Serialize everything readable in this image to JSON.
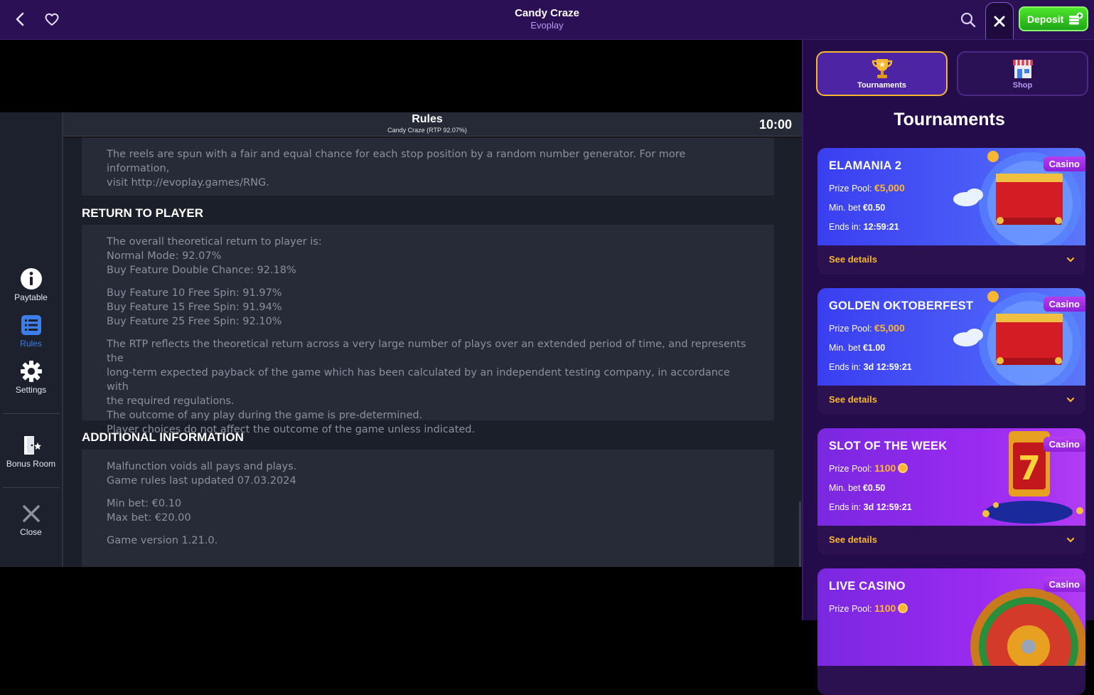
{
  "header": {
    "title": "Candy Craze",
    "provider": "Evoplay",
    "deposit_label": "Deposit"
  },
  "leftnav": {
    "paytable": "Paytable",
    "rules": "Rules",
    "settings": "Settings",
    "bonus_room": "Bonus Room",
    "close": "Close"
  },
  "rules": {
    "title": "Rules",
    "subtitle": "Candy Craze (RTP 92.07%)",
    "clock": "10:00",
    "rng_line1": "The reels are spun with a fair and equal chance for each stop position by a random number generator. For more information,",
    "rng_line2": "visit http://evoplay.games/RNG.",
    "rtp_heading": "RETURN TO PLAYER",
    "rtp_lines": [
      "The overall theoretical return to player is:",
      "Normal Mode: 92.07%",
      "Buy Feature Double Chance: 92.18%",
      "Buy Feature 10 Free Spin: 91.97%",
      "Buy Feature 15 Free Spin: 91.94%",
      "Buy Feature 25 Free Spin: 92.10%",
      "The RTP reflects the theoretical return across a very large number of plays over an extended period of time, and represents the",
      "long-term expected payback of the game which has been calculated by an independent testing company, in accordance with",
      "the required regulations.",
      "The outcome of any play during the game is pre-determined.",
      "Player choices do not affect the outcome of the game unless indicated."
    ],
    "additional_heading": "ADDITIONAL INFORMATION",
    "additional_lines": [
      "Malfunction voids all pays and plays.",
      "Game rules last updated 07.03.2024",
      "Min bet: €0.10",
      "Max bet: €20.00",
      "Game version 1.21.0."
    ]
  },
  "panel": {
    "tab_tournaments": "Tournaments",
    "tab_shop": "Shop",
    "title": "Tournaments",
    "see_details": "See details",
    "labels": {
      "prize_pool": "Prize Pool:",
      "min_bet": "Min. bet",
      "ends_in": "Ends in:"
    },
    "cards": [
      {
        "name": "ELAMANIA 2",
        "badge": "Casino",
        "prize": "€5,000",
        "min_bet": "€0.50",
        "ends": "12:59:21"
      },
      {
        "name": "GOLDEN OKTOBERFEST",
        "badge": "Casino",
        "prize": "€5,000",
        "min_bet": "€1.00",
        "ends": "3d 12:59:21"
      },
      {
        "name": "SLOT OF THE WEEK",
        "badge": "Casino",
        "prize": "1100",
        "min_bet": "€0.50",
        "ends": "3d 12:59:21"
      },
      {
        "name": "LIVE CASINO",
        "badge": "Casino",
        "prize": "1100"
      }
    ]
  }
}
